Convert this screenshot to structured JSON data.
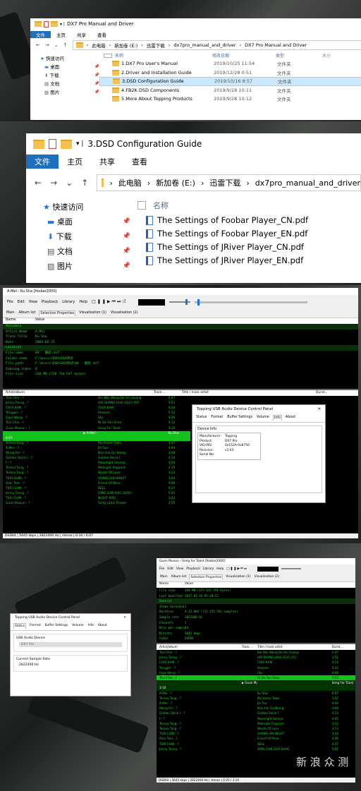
{
  "shot1": {
    "title": "DX7 Pro Manual and Driver",
    "ribbon": [
      "文件",
      "主页",
      "共享",
      "查看"
    ],
    "crumbs": [
      "此电脑",
      "新加卷 (E:)",
      "迅雷下载",
      "dx7pro_manual_and_driver",
      "DX7 Pro Manual and Driver"
    ],
    "cols": [
      "名称",
      "修改日期",
      "类型",
      "大小"
    ],
    "nav": [
      {
        "label": "快速访问",
        "icon": "star-icon"
      },
      {
        "label": "桌面",
        "icon": "desktop-icon"
      },
      {
        "label": "下载",
        "icon": "download-icon"
      },
      {
        "label": "文档",
        "icon": "document-icon"
      },
      {
        "label": "图片",
        "icon": "picture-icon"
      }
    ],
    "files": [
      {
        "name": "1.DX7 Pro User's Manual",
        "date": "2019/10/25 11:54",
        "type": "文件夹"
      },
      {
        "name": "2.Driver and  Installation Guide",
        "date": "2019/12/28 0:51",
        "type": "文件夹"
      },
      {
        "name": "3.DSD Configuration Guide",
        "date": "2019/10/16 8:57",
        "type": "文件夹"
      },
      {
        "name": "4.FB2K DSD Components",
        "date": "2019/9/28 10:11",
        "type": "文件夹"
      },
      {
        "name": "5.More About Topping Products",
        "date": "2019/9/28 10:12",
        "type": "文件夹"
      }
    ]
  },
  "shot2": {
    "title": "3.DSD Configuration Guide",
    "ribbon": [
      "文件",
      "主页",
      "共享",
      "查看"
    ],
    "crumbs": [
      "此电脑",
      "新加卷 (E:)",
      "迅雷下载",
      "dx7pro_manual_and_driver"
    ],
    "nav": [
      {
        "label": "快速访问"
      },
      {
        "label": "桌面"
      },
      {
        "label": "下载"
      },
      {
        "label": "文档"
      },
      {
        "label": "图片"
      }
    ],
    "col": "名称",
    "files": [
      "The Settings of Foobar Player_CN.pdf",
      "The Settings of Foobar Player_EN.pdf",
      "The Settings of JRiver Player_CN.pdf",
      "The Settings of JRiver Player_EN.pdf"
    ]
  },
  "shot3": {
    "title": "A-Mei - Ku Sha  [foobar2000]",
    "menu": [
      "File",
      "Edit",
      "View",
      "Playback",
      "Library",
      "Help"
    ],
    "tabs": [
      "Main",
      "Album list",
      "Selection Properties",
      "Visualisation (1)",
      "Visualisation (2)"
    ],
    "props_head": [
      "Name",
      "Value"
    ],
    "props": [
      {
        "k": "Metadata",
        "v": "",
        "sec": true
      },
      {
        "k": "Artist Name",
        "v": "A-Mei"
      },
      {
        "k": "Track Title",
        "v": "Ku Sha"
      },
      {
        "k": "Date",
        "v": "2004-02-25"
      },
      {
        "k": "",
        "v": ""
      },
      {
        "k": "Location",
        "v": "",
        "sec": true
      },
      {
        "k": "File name",
        "v": "04 - 酷砂.dsf"
      },
      {
        "k": "Folder name",
        "v": "F:\\music\\DSD\\DSD测试"
      },
      {
        "k": "File path",
        "v": "F:\\music\\DSD\\DSD测试\\04 - 酷砂.dsf"
      },
      {
        "k": "Subsong index",
        "v": "0"
      },
      {
        "k": "File size",
        "v": "246 MB (258 744 547 bytes)"
      }
    ],
    "pl_head": [
      "Artist/album",
      "Track ...",
      "Title / track artist",
      "Durat..."
    ],
    "pl": [
      [
        "Tsai Chin - ?",
        "",
        "Bei Wei Wang De Shi Guang",
        "2:47"
      ],
      [
        "Jenny Tseng - ?",
        "",
        "HAI SHANG HUA (GUO YU)",
        "3:51"
      ],
      [
        "CHOI KAM - ?",
        "",
        "CHOI KAM",
        "4:14"
      ],
      [
        "Tengger - ?",
        "",
        "Heaven",
        "5:12"
      ],
      [
        "Faye Wong - ?",
        "",
        "Sky",
        "4:46"
      ],
      [
        "Tsai Chin - ?",
        "",
        "Ni De Yan Shen",
        "4:12"
      ],
      [
        "Guan Muxun - ?",
        "",
        "Song For Toast",
        "3:10"
      ],
      [
        "A-Mei - ?",
        "",
        "Ku Sha",
        "6:07"
      ],
      [
        "Teresa Tang - ?",
        "",
        "My Home Town",
        "3:37"
      ],
      [
        "A-Mei - ?",
        "",
        "Jie Tuo",
        "4:44"
      ],
      [
        "Wong Fei - ?",
        "",
        "Nan Hai Gu Niang",
        "3:08"
      ],
      [
        "Golden Voice I - ?",
        "",
        "Golden Voice I",
        "4:14"
      ],
      [
        "f - ?",
        "",
        "Moonlight Serena",
        "4:00"
      ],
      [
        "Teresa Tang - ?",
        "",
        "Midnight Fragrant",
        "3:15"
      ],
      [
        "Teresa Tang - ?",
        "",
        "Words Of Love",
        "3:13"
      ],
      [
        "TSAI CHIN - ?",
        "",
        "SHANG HAI NIGHT",
        "3:44"
      ],
      [
        "Alan Tam - ?",
        "",
        "Friend Of Mine",
        "4:46"
      ],
      [
        "TSAI CHIN - ?",
        "",
        "BELL",
        "4:37"
      ],
      [
        "Jenny Tseng - ?",
        "",
        "QING GAN GAO SHAO",
        "5:01"
      ],
      [
        "TSAI CHIN - ?",
        "",
        "NIGHT KISS",
        "3:22"
      ],
      [
        "Guan Muxun - ?",
        "",
        "Song Lotus Flower",
        "3:55"
      ]
    ],
    "playing_index": 7,
    "status": "DSD64 | 5645 kbps | 2822400 Hz | stereo | 0:34 / 6:07",
    "cp": {
      "title": "Topping USB Audio Device Control Panel",
      "tabs": [
        "Status",
        "Format",
        "Buffer Settings",
        "Volume",
        "Info",
        "About"
      ],
      "group": "Device Info",
      "info": [
        [
          "Manufacturer:",
          "Topping"
        ],
        [
          "Product:",
          "DX7 Pro"
        ],
        [
          "VID-PID:",
          "0x152A-0x8750"
        ],
        [
          "Revision:",
          "v1.03"
        ],
        [
          "Serial No:",
          ""
        ]
      ]
    }
  },
  "shot4": {
    "title": "Guan Muxun - Song for Toast  [foobar2000]",
    "menu": [
      "File",
      "Edit",
      "View",
      "Playback",
      "Library",
      "Help"
    ],
    "tabs": [
      "Main",
      "Album list",
      "Selection Properties",
      "Visualisation (1)",
      "Visualisation (2)"
    ],
    "props_head": [
      "Name",
      "Value"
    ],
    "props": [
      {
        "k": "File size",
        "v": "169 MB (177 815 791 bytes)"
      },
      {
        "k": "Last modified",
        "v": "2017-01-16 05:26:52"
      },
      {
        "k": "General",
        "v": "",
        "sec": true
      },
      {
        "k": "Items Selected",
        "v": "1"
      },
      {
        "k": "Duration",
        "v": "4:12.004 (711 255 552 samples)"
      },
      {
        "k": "Sample rate",
        "v": "2822400 Hz"
      },
      {
        "k": "Channels",
        "v": "2"
      },
      {
        "k": "Bits per sample",
        "v": "24"
      },
      {
        "k": "Bitrate",
        "v": "5645 kbps"
      },
      {
        "k": "Codec",
        "v": "DSD64"
      }
    ],
    "pl_head": [
      "Artist/album",
      "Track ...",
      "Title / track artist",
      "Durat..."
    ],
    "pl": [
      [
        "Tsai Chin - ?",
        "",
        "Bei Wei Wang De Shi Guang",
        "2:47"
      ],
      [
        "Jenny Tseng - ?",
        "",
        "HAI SHANG HUA (GUO YU)",
        "3:51"
      ],
      [
        "CHOI KAM - ?",
        "",
        "CHOI KAM",
        "4:14"
      ],
      [
        "Tengger - ?",
        "",
        "Heaven",
        "5:12"
      ],
      [
        "Faye Wong - ?",
        "",
        "Sky",
        "4:46"
      ],
      [
        "Tsai Chin - ?",
        "",
        "Ni De Yan Shen",
        "4:12"
      ],
      [
        "Guan Muxun - ?",
        "",
        "Song For Toast",
        "3:10"
      ],
      [
        "A-Mei - ?",
        "",
        "Ku Sha",
        "6:07"
      ],
      [
        "Teresa Tang - ?",
        "",
        "My Home Town",
        "3:37"
      ],
      [
        "A-Mei - ?",
        "",
        "Jie Tuo",
        "4:44"
      ],
      [
        "Wong Fei - ?",
        "",
        "Nan Hai Gu Niang",
        "3:08"
      ],
      [
        "Golden Voice I - ?",
        "",
        "Golden Voice I",
        "4:14"
      ],
      [
        "f - ?",
        "",
        "Moonlight Serena",
        "4:00"
      ],
      [
        "Teresa Tang - ?",
        "",
        "Midnight Fragrant",
        "3:15"
      ],
      [
        "Teresa Tang - ?",
        "",
        "Words Of Love",
        "3:13"
      ],
      [
        "TSAI CHIN - ?",
        "",
        "SHANG HAI NIGHT",
        "3:44"
      ],
      [
        "Alan Tam - ?",
        "",
        "Friend Of Mine",
        "4:46"
      ],
      [
        "TSAI CHIN - ?",
        "",
        "BELL",
        "4:37"
      ],
      [
        "Jenny Tseng - ?",
        "",
        "QING GAN GAO SHAO",
        "5:01"
      ]
    ],
    "selected_index": 5,
    "playing_index": 6,
    "status": "DSD64 | 5645 kbps | 2822400 Hz | stereo | 0:25 / 3:10",
    "cp": {
      "title": "Topping USB Audio Device Control Panel",
      "tabs": [
        "Status",
        "Format",
        "Buffer Settings",
        "Volume",
        "Info",
        "About"
      ],
      "g1": "USB Audio Device",
      "v1": "DX7 Pro",
      "g2": "Current Sample Rate",
      "v2": "2822400 Hz"
    }
  },
  "watermark": "新 浪 众 测"
}
